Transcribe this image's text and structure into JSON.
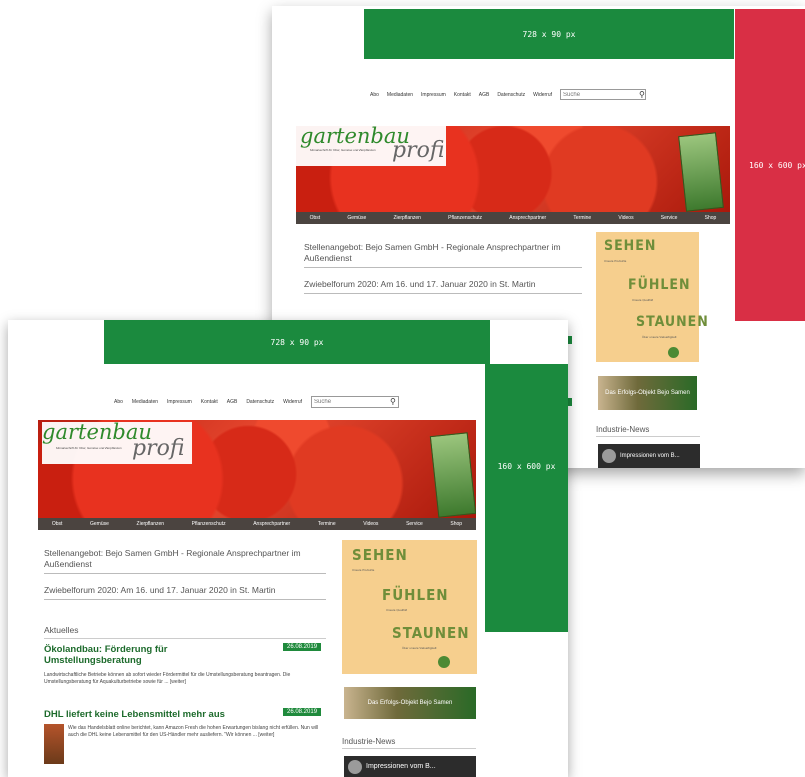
{
  "ads": {
    "leaderboard": "728 x 90 px",
    "skyscraper": "160 x 600 px"
  },
  "nav": {
    "items": [
      "Abo",
      "Mediadaten",
      "Impressum",
      "Kontakt",
      "AGB",
      "Datenschutz",
      "Widerruf"
    ],
    "search_placeholder": "Suche"
  },
  "logo": {
    "word1": "gartenbau",
    "word2": "profi",
    "tagline": "Monatsschrift für Obst, Gemüse und Zierpflanzen"
  },
  "menu": [
    "Obst",
    "Gemüse",
    "Zierpflanzen",
    "Pflanzenschutz",
    "Ansprechpartner",
    "Termine",
    "Videos",
    "Service",
    "Shop"
  ],
  "articles": [
    "Stellenangebot: Bejo Samen GmbH - Regionale Ansprechpartner im Außendienst",
    "Zwiebelforum 2020: Am 16. und 17. Januar 2020 in St. Martin"
  ],
  "section_title": "Aktuelles",
  "news": [
    {
      "title": "Ökolandbau: Förderung für Umstellungsberatung",
      "date": "26.08.2019",
      "excerpt": "Landwirtschaftliche Betriebe können ab sofort wieder Fördermittel für die Umstellungsberatung beantragen. Die Umstellungsberatung für Aquakulturbetriebe sowie für ... [weiter]"
    },
    {
      "title": "DHL liefert keine Lebensmittel mehr aus",
      "date": "26.08.2019",
      "excerpt": "Wie das Handelsblatt online berichtet, kann Amazon Fresh die hohen Erwartungen bislang nicht erfüllen. Nun will auch die DHL keine Lebensmittel für den US-Händler mehr ausliefern. \"Wir können ... [weiter]"
    }
  ],
  "promo": {
    "line1": "SEHEN",
    "sub1": "Unsere Produkte",
    "line2": "FÜHLEN",
    "sub2": "Unsere Qualität",
    "line3": "STAUNEN",
    "sub3": "Über unsere Vielseitigkeit"
  },
  "banner2": "Das Erfolgs-Objekt Bejo Samen",
  "industrie": "Industrie-News",
  "video": "Impressionen vom B...",
  "colors": {
    "ad_green": "#1b8a3e",
    "ad_red": "#d92f45",
    "menu_bar": "#4b4440",
    "date_badge": "#1f8a3c"
  }
}
